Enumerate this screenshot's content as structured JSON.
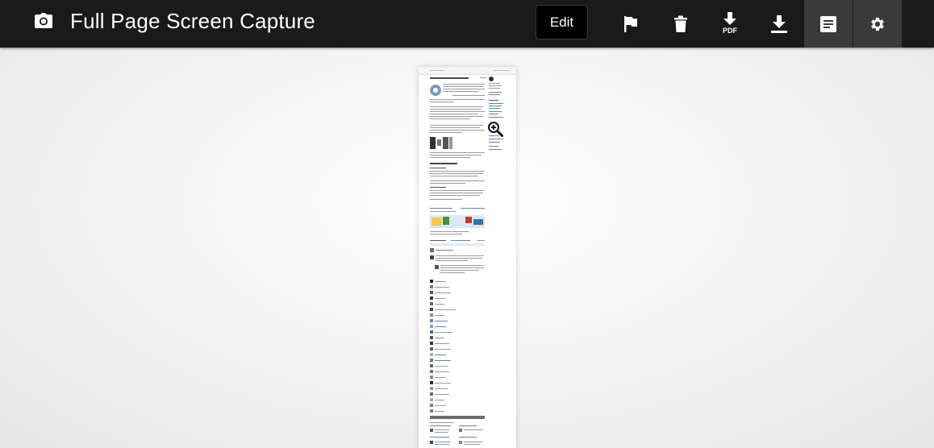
{
  "header": {
    "app_icon": "camera-icon",
    "title": "Full Page Screen Capture",
    "edit_label": "Edit"
  },
  "toolbar": [
    {
      "name": "flag-button",
      "icon": "flag-icon"
    },
    {
      "name": "delete-button",
      "icon": "trash-icon"
    },
    {
      "name": "download-pdf-button",
      "icon": "download-pdf-icon",
      "badge": "PDF"
    },
    {
      "name": "download-button",
      "icon": "download-icon"
    },
    {
      "name": "notes-button",
      "icon": "notes-icon",
      "active": true
    },
    {
      "name": "settings-button",
      "icon": "gear-icon",
      "active": true
    }
  ],
  "colors": {
    "topbar": "#1a1a1a",
    "active_tool": "#3a3a3a",
    "page_background": "#f0f0f0",
    "link_blue": "#5f85b5"
  },
  "preview": {
    "zoom_icon": "zoom-in-icon"
  }
}
